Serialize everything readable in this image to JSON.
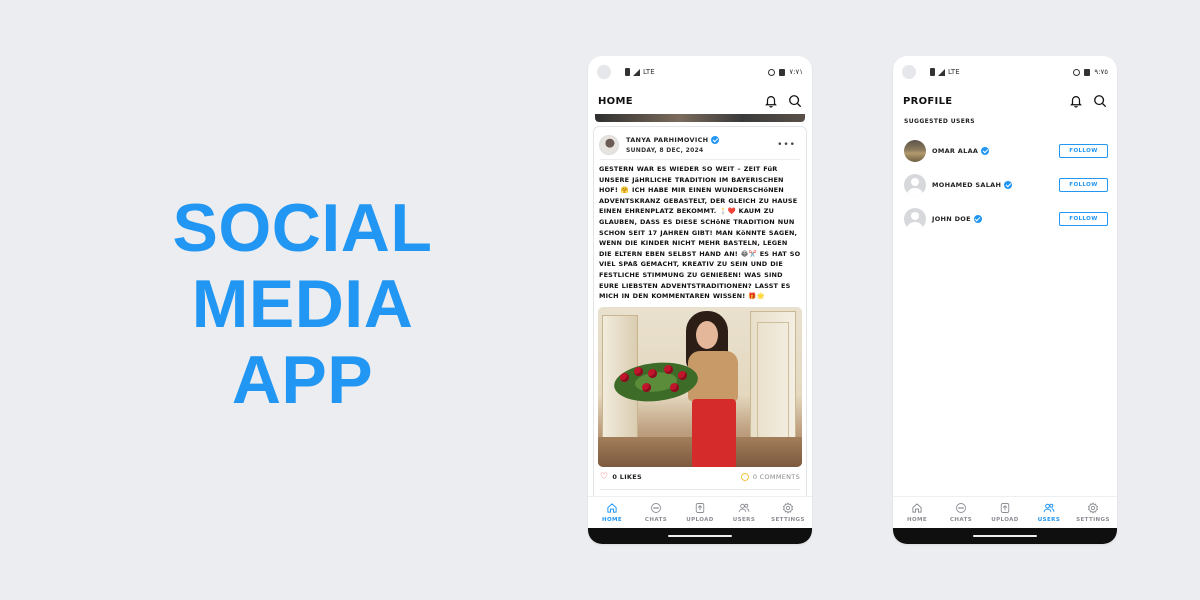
{
  "headline": {
    "line1": "SOCIAL",
    "line2": "MEDIA",
    "line3": "APP"
  },
  "colors": {
    "background": "#ebedf0",
    "accent": "#2196f3",
    "like": "#e53935"
  },
  "status_bar": {
    "network": "LTE",
    "time": "٧:٧١"
  },
  "status_bar_right": {
    "network": "LTE",
    "time": "٩:٧٥"
  },
  "home_screen": {
    "title": "HOME",
    "post": {
      "author": "TANYA PARHIMOVICH",
      "date": "SUNDAY, 8 DEC, 2024",
      "more_label": "•••",
      "text": "GESTERN WAR ES WIEDER SO WEIT – ZEIT FüR UNSERE JäHRLICHE TRADITION IM BAYERISCHEN HOF! 🤗 ICH HABE MIR EINEN WUNDERSCHöNEN ADVENTSKRANZ GEBASTELT, DER GLEICH ZU HAUSE EINEN EHRENPLATZ BEKOMMT. 🕯️❤️ KAUM ZU GLAUBEN, DASS ES DIESE SCHöNE TRADITION NUN SCHON SEIT 17 JAHREN GIBT! MAN KöNNTE SAGEN, WENN DIE KINDER NICHT MEHR BASTELN, LEGEN DIE ELTERN EBEN SELBST HAND AN! 😂✂️ ES HAT SO VIEL SPAß GEMACHT, KREATIV ZU SEIN UND DIE FESTLICHE STIMMUNG ZU GENIEßEN! WAS SIND EURE LIEBSTEN ADVENTSTRADITIONEN? LASST ES MICH IN DEN KOMMENTAREN WISSEN! 🎁🌟",
      "likes": "0 LIKES",
      "comments": "0 COMMENTS"
    }
  },
  "profile_screen": {
    "title": "PROFILE",
    "section_label": "SUGGESTED USERS",
    "users": [
      {
        "name": "OMAR ALAA",
        "button": "FOLLOW"
      },
      {
        "name": "MOHAMED SALAH",
        "button": "FOLLOW"
      },
      {
        "name": "JOHN DOE",
        "button": "FOLLOW"
      }
    ]
  },
  "nav": {
    "items": [
      {
        "label": "HOME",
        "icon": "home-icon"
      },
      {
        "label": "CHATS",
        "icon": "chat-icon"
      },
      {
        "label": "UPLOAD",
        "icon": "upload-icon"
      },
      {
        "label": "USERS",
        "icon": "users-icon"
      },
      {
        "label": "SETTINGS",
        "icon": "gear-icon"
      }
    ]
  }
}
